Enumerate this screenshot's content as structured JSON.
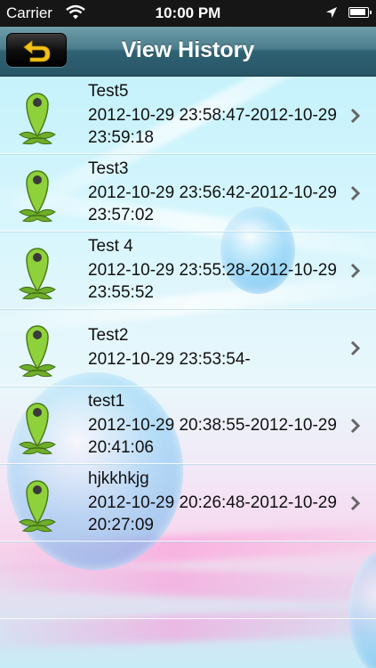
{
  "status_bar": {
    "carrier": "Carrier",
    "time": "10:00 PM",
    "icons": [
      "wifi-icon",
      "location-arrow-icon",
      "battery-icon"
    ]
  },
  "nav": {
    "title": "View History",
    "back_icon": "undo-arrow-icon",
    "back_icon_color": "#f2c318"
  },
  "history": [
    {
      "name": "Test5",
      "range": "2012-10-29 23:58:47-2012-10-29 23:59:18"
    },
    {
      "name": "Test3",
      "range": "2012-10-29 23:56:42-2012-10-29 23:57:02"
    },
    {
      "name": "Test 4",
      "range": "2012-10-29 23:55:28-2012-10-29 23:55:52"
    },
    {
      "name": "Test2",
      "range": "2012-10-29 23:53:54-"
    },
    {
      "name": "test1",
      "range": "2012-10-29 20:38:55-2012-10-29 20:41:06"
    },
    {
      "name": "hjkkhkjg",
      "range": "2012-10-29 20:26:48-2012-10-29 20:27:09"
    }
  ],
  "row_icon": "map-pin-icon",
  "row_icon_color": "#8fd13a",
  "chevron_color": "#666666"
}
